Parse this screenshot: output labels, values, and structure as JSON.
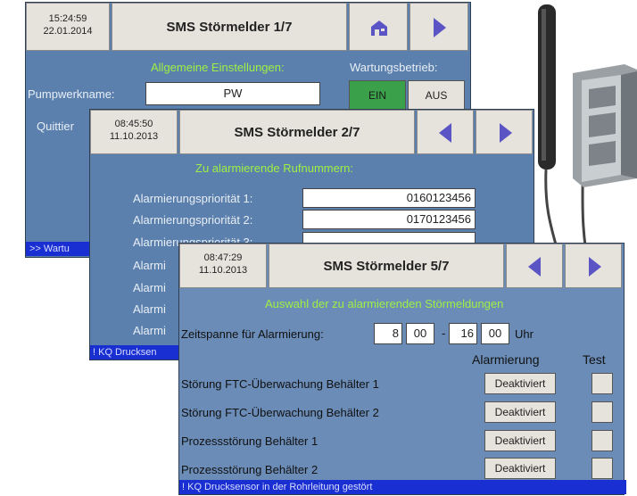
{
  "screen1": {
    "time": "15:24:59",
    "date": "22.01.2014",
    "title": "SMS Störmelder 1/7",
    "section": "Allgemeine Einstellungen:",
    "maintenance_label": "Wartungsbetrieb:",
    "pump_label": "Pumpwerkname:",
    "pump_value": "PW",
    "on_label": "EIN",
    "off_label": "AUS",
    "ack_label": "Quittier",
    "status_text": ">> Wartu",
    "icon": "home-icon"
  },
  "screen2": {
    "time": "08:45:50",
    "date": "11.10.2013",
    "title": "SMS Störmelder 2/7",
    "section": "Zu alarmierende Rufnummern:",
    "rows": [
      {
        "label": "Alarmierungspriorität 1:",
        "value": "0160123456"
      },
      {
        "label": "Alarmierungspriorität 2:",
        "value": "0170123456"
      },
      {
        "label": "Alarmierungspriorität 3:",
        "value": ""
      },
      {
        "label": "Alarmi",
        "value": ""
      },
      {
        "label": "Alarmi",
        "value": ""
      },
      {
        "label": "Alarmi",
        "value": ""
      },
      {
        "label": "Alarmi",
        "value": ""
      }
    ],
    "status_text": "! KQ Drucksen"
  },
  "screen5": {
    "time": "08:47:29",
    "date": "11.10.2013",
    "title": "SMS Störmelder 5/7",
    "section": "Auswahl der zu alarmierenden Störmeldungen",
    "period_label": "Zeitspanne für Alarmierung:",
    "from_h": "8",
    "from_m": "00",
    "dash": "-",
    "to_h": "16",
    "to_m": "00",
    "unit": "Uhr",
    "col_alarm": "Alarmierung",
    "col_test": "Test",
    "rows": [
      {
        "label": "Störung FTC-Überwachung Behälter 1",
        "button": "Deaktiviert"
      },
      {
        "label": "Störung FTC-Überwachung Behälter 2",
        "button": "Deaktiviert"
      },
      {
        "label": "Prozessstörung Behälter 1",
        "button": "Deaktiviert"
      },
      {
        "label": "Prozessstörung Behälter 2",
        "button": "Deaktiviert"
      }
    ],
    "status_text": "! KQ Drucksensor in der Rohrleitung gestört"
  },
  "colors": {
    "panel": "#5b80ad",
    "accent_green": "#9ff043",
    "status_blue": "#1a2fd2",
    "on_button": "#3aa04a"
  }
}
